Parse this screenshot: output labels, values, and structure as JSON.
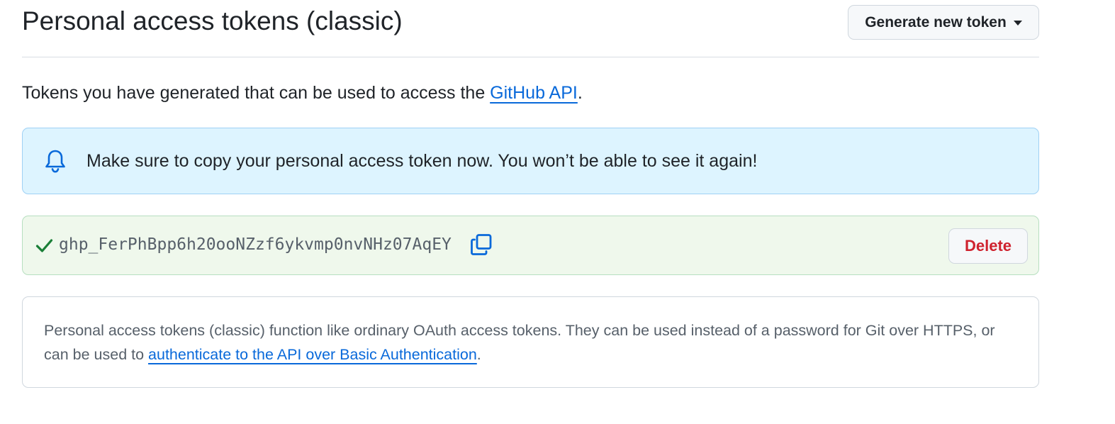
{
  "header": {
    "title": "Personal access tokens (classic)",
    "generate_button_label": "Generate new token"
  },
  "intro": {
    "text_before": "Tokens you have generated that can be used to access the ",
    "link_label": "GitHub API",
    "text_after": "."
  },
  "flash": {
    "icon": "bell-icon",
    "message": "Make sure to copy your personal access token now. You won’t be able to see it again!"
  },
  "token": {
    "status_icon": "check-icon",
    "value": "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",
    "copy_icon": "copy-icon",
    "delete_label": "Delete"
  },
  "info": {
    "text_before": "Personal access tokens (classic) function like ordinary OAuth access tokens. They can be used instead of a password for Git over HTTPS, or can be used to ",
    "link_label": "authenticate to the API over Basic Authentication",
    "text_after": "."
  },
  "colors": {
    "link": "#0969da",
    "danger": "#cf222e",
    "success": "#1a7f37",
    "flash_bg": "#ddf4ff",
    "token_bg": "#eff8ec"
  }
}
